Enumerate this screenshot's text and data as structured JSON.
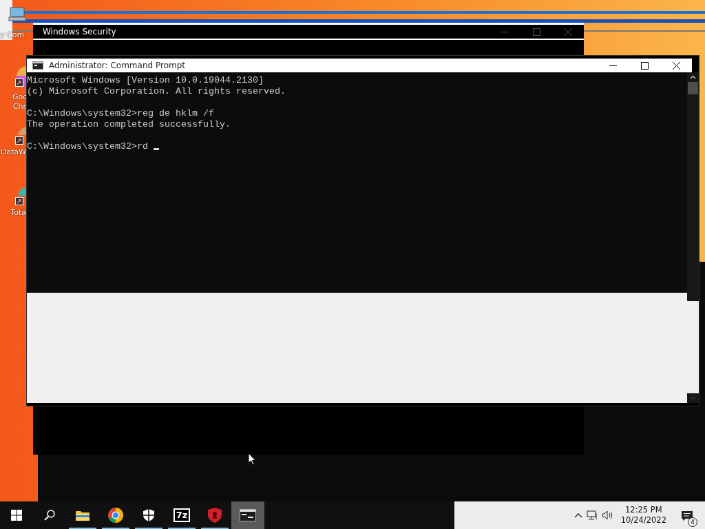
{
  "desktop_icons": [
    {
      "kind": "computer",
      "label": "y Com"
    },
    {
      "kind": "chrome",
      "label": "Goo Chr"
    },
    {
      "kind": "app",
      "label": "DataW"
    },
    {
      "kind": "app",
      "label": "Tota"
    }
  ],
  "security_window": {
    "title": "Windows Security"
  },
  "cmd_window": {
    "title": "Administrator: Command Prompt",
    "paragraphs": [
      [
        "Microsoft Windows [Version 10.0.19044.2130]",
        "(c) Microsoft Corporation. All rights reserved."
      ],
      [
        "C:\\Windows\\system32>reg de hklm /f",
        "The operation completed successfully."
      ],
      [
        "C:\\Windows\\system32>rd"
      ]
    ],
    "cursor_visible": true
  },
  "taskbar": {
    "apps": [
      {
        "kind": "explorer",
        "running": true,
        "active": false
      },
      {
        "kind": "chrome",
        "running": true,
        "active": false
      },
      {
        "kind": "security",
        "running": true,
        "active": false
      },
      {
        "kind": "zip",
        "label": "7z",
        "running": true,
        "active": false
      },
      {
        "kind": "redshield",
        "running": true,
        "active": false
      },
      {
        "kind": "cmd",
        "running": true,
        "active": true
      }
    ],
    "clock": {
      "time": "12:25 PM",
      "date": "10/24/2022"
    },
    "notifications": "4"
  }
}
